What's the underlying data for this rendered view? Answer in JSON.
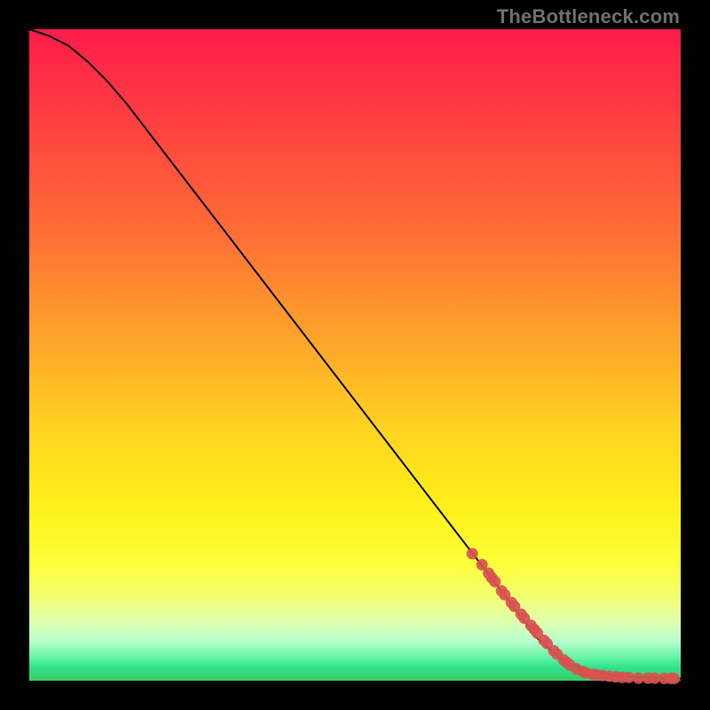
{
  "watermark": "TheBottleneck.com",
  "chart_data": {
    "type": "line",
    "title": "",
    "xlabel": "",
    "ylabel": "",
    "xlim": [
      0,
      100
    ],
    "ylim": [
      0,
      100
    ],
    "grid": false,
    "legend": false,
    "background_gradient": [
      "#ff1c4b",
      "#ff6a36",
      "#ffd520",
      "#fdff3a",
      "#63f3a4",
      "#39cc64"
    ],
    "series": [
      {
        "name": "bottleneck-curve",
        "type": "line",
        "color": "#000000",
        "x": [
          0,
          3,
          6,
          9,
          12,
          15,
          20,
          30,
          40,
          50,
          60,
          70,
          78,
          82,
          86,
          90,
          94,
          98,
          100
        ],
        "y": [
          100,
          99,
          97.5,
          95,
          92,
          88.5,
          82,
          69,
          56,
          43,
          30,
          17,
          6.5,
          3,
          1.5,
          0.8,
          0.5,
          0.3,
          0.3
        ]
      },
      {
        "name": "data-points",
        "type": "scatter",
        "color": "#d9534f",
        "x": [
          68,
          69.5,
          70.5,
          71,
          71.5,
          72.5,
          73,
          74,
          74.5,
          75.5,
          76,
          77,
          77.5,
          78,
          79,
          79.5,
          80.5,
          81,
          82,
          82.5,
          83,
          84,
          85,
          85.5,
          86.5,
          87,
          88,
          89,
          90,
          91,
          92,
          93.5,
          95,
          96,
          97.5,
          98.5,
          99
        ],
        "y": [
          19.5,
          17.8,
          16.5,
          15.8,
          15.2,
          13.8,
          13.2,
          12,
          11.4,
          10.2,
          9.6,
          8.5,
          7.9,
          7.3,
          6.2,
          5.7,
          4.6,
          4.1,
          3.2,
          2.8,
          2.4,
          1.8,
          1.4,
          1.2,
          1,
          0.9,
          0.8,
          0.7,
          0.6,
          0.5,
          0.5,
          0.4,
          0.4,
          0.4,
          0.35,
          0.35,
          0.35
        ]
      }
    ]
  }
}
